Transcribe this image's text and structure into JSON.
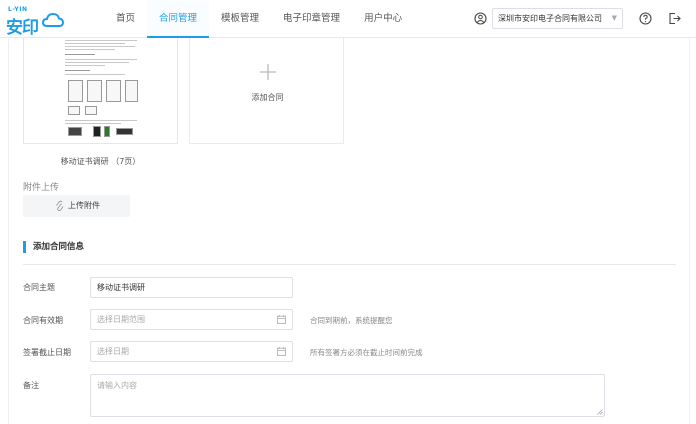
{
  "header": {
    "logo_small": "L-YIN",
    "logo_main": "安印",
    "nav": [
      {
        "label": "首页",
        "active": false
      },
      {
        "label": "合同管理",
        "active": true
      },
      {
        "label": "模板管理",
        "active": false
      },
      {
        "label": "电子印章管理",
        "active": false
      },
      {
        "label": "用户中心",
        "active": false
      }
    ],
    "company": "深圳市安印电子合同有限公司",
    "accent_color": "#1e9de6"
  },
  "documents": {
    "file_name": "移动证书调研 （7页）",
    "add_label": "添加合同"
  },
  "attachments": {
    "title": "附件上传",
    "upload_label": "上传附件"
  },
  "form": {
    "section_title": "添加合同信息",
    "subject_label": "合同主题",
    "subject_value": "移动证书调研",
    "validity_label": "合同有效期",
    "validity_placeholder": "选择日期范围",
    "validity_hint": "合同到期前，系统提醒您",
    "deadline_label": "签署截止日期",
    "deadline_placeholder": "选择日期",
    "deadline_hint": "所有签署方必须在截止时间前完成",
    "remark_label": "备注",
    "remark_placeholder": "请输入内容"
  }
}
